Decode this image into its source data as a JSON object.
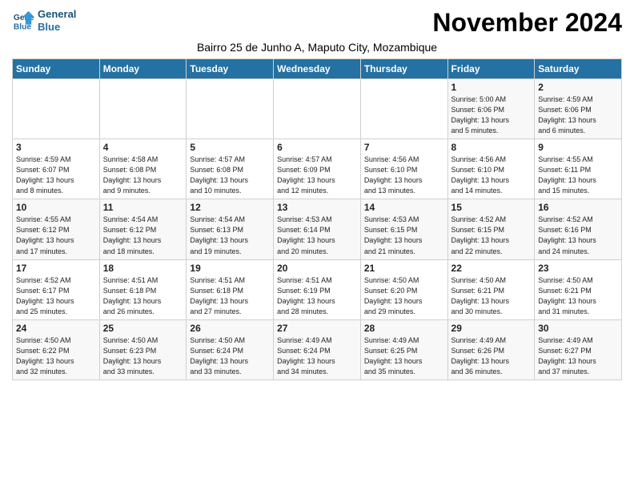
{
  "header": {
    "logo_line1": "General",
    "logo_line2": "Blue",
    "title": "November 2024",
    "subtitle": "Bairro 25 de Junho A, Maputo City, Mozambique"
  },
  "days_of_week": [
    "Sunday",
    "Monday",
    "Tuesday",
    "Wednesday",
    "Thursday",
    "Friday",
    "Saturday"
  ],
  "weeks": [
    [
      {
        "day": "",
        "info": ""
      },
      {
        "day": "",
        "info": ""
      },
      {
        "day": "",
        "info": ""
      },
      {
        "day": "",
        "info": ""
      },
      {
        "day": "",
        "info": ""
      },
      {
        "day": "1",
        "info": "Sunrise: 5:00 AM\nSunset: 6:06 PM\nDaylight: 13 hours\nand 5 minutes."
      },
      {
        "day": "2",
        "info": "Sunrise: 4:59 AM\nSunset: 6:06 PM\nDaylight: 13 hours\nand 6 minutes."
      }
    ],
    [
      {
        "day": "3",
        "info": "Sunrise: 4:59 AM\nSunset: 6:07 PM\nDaylight: 13 hours\nand 8 minutes."
      },
      {
        "day": "4",
        "info": "Sunrise: 4:58 AM\nSunset: 6:08 PM\nDaylight: 13 hours\nand 9 minutes."
      },
      {
        "day": "5",
        "info": "Sunrise: 4:57 AM\nSunset: 6:08 PM\nDaylight: 13 hours\nand 10 minutes."
      },
      {
        "day": "6",
        "info": "Sunrise: 4:57 AM\nSunset: 6:09 PM\nDaylight: 13 hours\nand 12 minutes."
      },
      {
        "day": "7",
        "info": "Sunrise: 4:56 AM\nSunset: 6:10 PM\nDaylight: 13 hours\nand 13 minutes."
      },
      {
        "day": "8",
        "info": "Sunrise: 4:56 AM\nSunset: 6:10 PM\nDaylight: 13 hours\nand 14 minutes."
      },
      {
        "day": "9",
        "info": "Sunrise: 4:55 AM\nSunset: 6:11 PM\nDaylight: 13 hours\nand 15 minutes."
      }
    ],
    [
      {
        "day": "10",
        "info": "Sunrise: 4:55 AM\nSunset: 6:12 PM\nDaylight: 13 hours\nand 17 minutes."
      },
      {
        "day": "11",
        "info": "Sunrise: 4:54 AM\nSunset: 6:12 PM\nDaylight: 13 hours\nand 18 minutes."
      },
      {
        "day": "12",
        "info": "Sunrise: 4:54 AM\nSunset: 6:13 PM\nDaylight: 13 hours\nand 19 minutes."
      },
      {
        "day": "13",
        "info": "Sunrise: 4:53 AM\nSunset: 6:14 PM\nDaylight: 13 hours\nand 20 minutes."
      },
      {
        "day": "14",
        "info": "Sunrise: 4:53 AM\nSunset: 6:15 PM\nDaylight: 13 hours\nand 21 minutes."
      },
      {
        "day": "15",
        "info": "Sunrise: 4:52 AM\nSunset: 6:15 PM\nDaylight: 13 hours\nand 22 minutes."
      },
      {
        "day": "16",
        "info": "Sunrise: 4:52 AM\nSunset: 6:16 PM\nDaylight: 13 hours\nand 24 minutes."
      }
    ],
    [
      {
        "day": "17",
        "info": "Sunrise: 4:52 AM\nSunset: 6:17 PM\nDaylight: 13 hours\nand 25 minutes."
      },
      {
        "day": "18",
        "info": "Sunrise: 4:51 AM\nSunset: 6:18 PM\nDaylight: 13 hours\nand 26 minutes."
      },
      {
        "day": "19",
        "info": "Sunrise: 4:51 AM\nSunset: 6:18 PM\nDaylight: 13 hours\nand 27 minutes."
      },
      {
        "day": "20",
        "info": "Sunrise: 4:51 AM\nSunset: 6:19 PM\nDaylight: 13 hours\nand 28 minutes."
      },
      {
        "day": "21",
        "info": "Sunrise: 4:50 AM\nSunset: 6:20 PM\nDaylight: 13 hours\nand 29 minutes."
      },
      {
        "day": "22",
        "info": "Sunrise: 4:50 AM\nSunset: 6:21 PM\nDaylight: 13 hours\nand 30 minutes."
      },
      {
        "day": "23",
        "info": "Sunrise: 4:50 AM\nSunset: 6:21 PM\nDaylight: 13 hours\nand 31 minutes."
      }
    ],
    [
      {
        "day": "24",
        "info": "Sunrise: 4:50 AM\nSunset: 6:22 PM\nDaylight: 13 hours\nand 32 minutes."
      },
      {
        "day": "25",
        "info": "Sunrise: 4:50 AM\nSunset: 6:23 PM\nDaylight: 13 hours\nand 33 minutes."
      },
      {
        "day": "26",
        "info": "Sunrise: 4:50 AM\nSunset: 6:24 PM\nDaylight: 13 hours\nand 33 minutes."
      },
      {
        "day": "27",
        "info": "Sunrise: 4:49 AM\nSunset: 6:24 PM\nDaylight: 13 hours\nand 34 minutes."
      },
      {
        "day": "28",
        "info": "Sunrise: 4:49 AM\nSunset: 6:25 PM\nDaylight: 13 hours\nand 35 minutes."
      },
      {
        "day": "29",
        "info": "Sunrise: 4:49 AM\nSunset: 6:26 PM\nDaylight: 13 hours\nand 36 minutes."
      },
      {
        "day": "30",
        "info": "Sunrise: 4:49 AM\nSunset: 6:27 PM\nDaylight: 13 hours\nand 37 minutes."
      }
    ]
  ]
}
